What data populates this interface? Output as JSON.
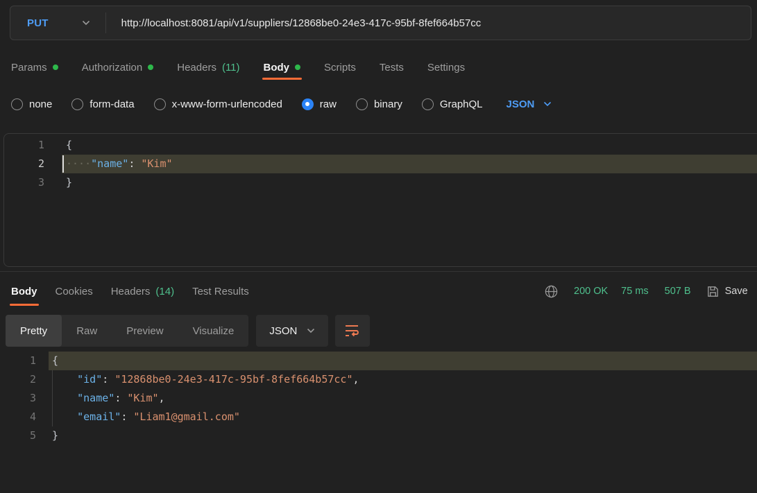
{
  "colors": {
    "accent_orange": "#ff6c37",
    "method_blue": "#4e9cf5",
    "dot_green": "#2eb84b",
    "mint_green": "#4fc08d",
    "key_blue": "#6cb2e8",
    "string_orange": "#da916f",
    "line_highlight": "#3f3e32",
    "background": "#212121"
  },
  "request": {
    "method": "PUT",
    "url": "http://localhost:8081/api/v1/suppliers/12868be0-24e3-417c-95bf-8fef664b57cc",
    "tabs": {
      "params": "Params",
      "authorization": "Authorization",
      "headers": "Headers",
      "headers_count": "(11)",
      "body": "Body",
      "scripts": "Scripts",
      "tests": "Tests",
      "settings": "Settings"
    },
    "body_types": {
      "none": "none",
      "form_data": "form-data",
      "urlencoded": "x-www-form-urlencoded",
      "raw": "raw",
      "binary": "binary",
      "graphql": "GraphQL",
      "language": "JSON"
    },
    "editor": {
      "nums": [
        "1",
        "2",
        "3"
      ],
      "open_brace": "{",
      "close_brace": "}",
      "indent_dots": "····",
      "name_key": "\"name\"",
      "colon": ": ",
      "name_value": "\"Kim\""
    }
  },
  "response": {
    "tabs": {
      "body": "Body",
      "cookies": "Cookies",
      "headers": "Headers",
      "headers_count": "(14)",
      "test_results": "Test Results"
    },
    "meta": {
      "status": "200 OK",
      "time": "75 ms",
      "size": "507 B",
      "save_label": "Save"
    },
    "views": {
      "pretty": "Pretty",
      "raw": "Raw",
      "preview": "Preview",
      "visualize": "Visualize",
      "language": "JSON"
    },
    "editor": {
      "nums": [
        "1",
        "2",
        "3",
        "4",
        "5"
      ],
      "open_brace": "{",
      "close_brace": "}",
      "indent": "    ",
      "colon": ": ",
      "comma": ",",
      "id_key": "\"id\"",
      "id_value": "\"12868be0-24e3-417c-95bf-8fef664b57cc\"",
      "name_key": "\"name\"",
      "name_value": "\"Kim\"",
      "email_key": "\"email\"",
      "email_value": "\"Liam1@gmail.com\""
    }
  }
}
